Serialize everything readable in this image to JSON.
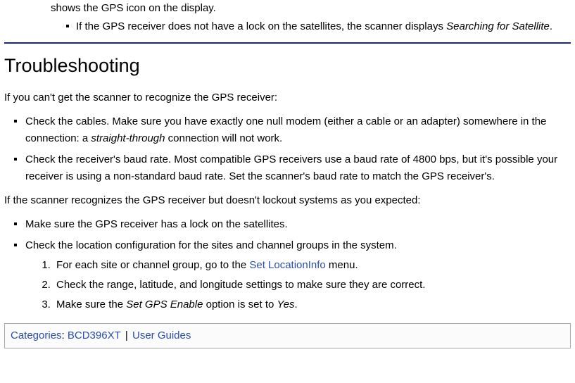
{
  "frag": {
    "partial_line": "shows the GPS icon on the display.",
    "sub_bullet_prefix": "If the GPS receiver does not have a lock on the satellites, the scanner displays ",
    "sub_bullet_italic": "Searching for Satellite",
    "sub_bullet_suffix": "."
  },
  "heading": "Troubleshooting",
  "intro1": "If you can't get the scanner to recognize the GPS receiver:",
  "list1": {
    "item1_prefix": "Check the cables. Make sure you have exactly one null modem (either a cable or an adapter) somewhere in the connection: a ",
    "item1_italic": "straight-through",
    "item1_suffix": " connection will not work.",
    "item2": "Check the receiver's baud rate. Most compatible GPS receivers use a baud rate of 4800 bps, but it's possible your receiver is using a non-standard baud rate. Set the scanner's baud rate to match the GPS receiver's."
  },
  "intro2": "If the scanner recognizes the GPS receiver but doesn't lockout systems as you expected:",
  "list2": {
    "item1": "Make sure the GPS receiver has a lock on the satellites.",
    "item2": "Check the location configuration for the sites and channel groups in the system."
  },
  "steps": {
    "s1_prefix": "For each site or channel group, go to the ",
    "s1_link": "Set LocationInfo",
    "s1_suffix": " menu.",
    "s2": "Check the range, latitude, and longitude settings to make sure they are correct.",
    "s3_prefix": "Make sure the ",
    "s3_italic": "Set GPS Enable",
    "s3_mid": " option is set to ",
    "s3_italic2": "Yes",
    "s3_suffix": "."
  },
  "categories": {
    "label": "Categories",
    "colon": ": ",
    "cat1": "BCD396XT",
    "sep": " | ",
    "cat2": "User Guides"
  }
}
